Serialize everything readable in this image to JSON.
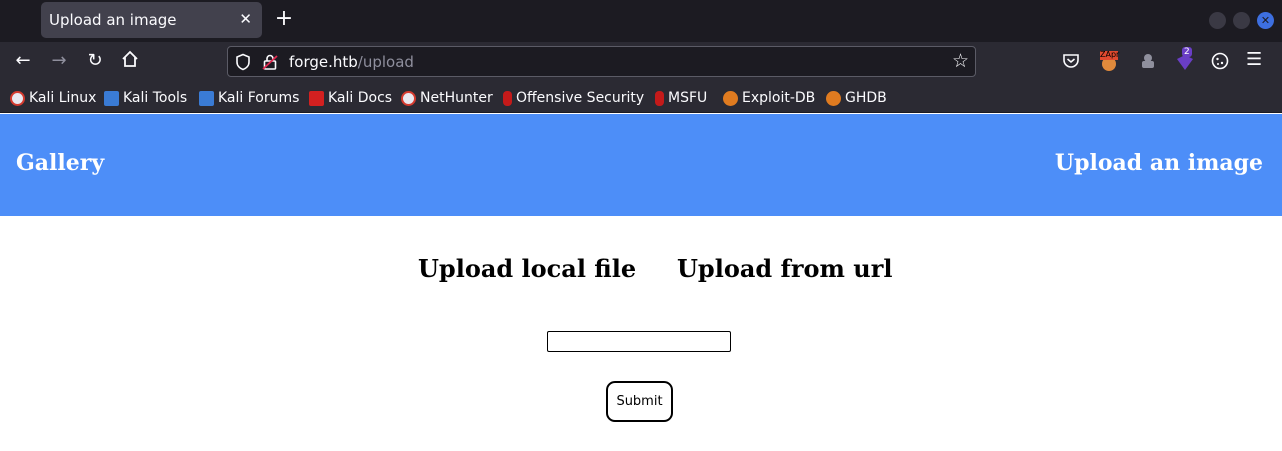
{
  "browser": {
    "tab": {
      "title": "Upload an image"
    },
    "url": {
      "host": "forge.htb",
      "path": "/upload"
    },
    "extensions": [
      {
        "name": "zap-extension",
        "badge": "ZApr"
      },
      {
        "name": "notify-extension",
        "badge": "2"
      }
    ],
    "bookmarks": [
      {
        "label": "Kali Linux",
        "icon": "kali-icon"
      },
      {
        "label": "Kali Tools",
        "icon": "kali-tools-icon"
      },
      {
        "label": "Kali Forums",
        "icon": "kali-forums-icon"
      },
      {
        "label": "Kali Docs",
        "icon": "kali-docs-icon"
      },
      {
        "label": "NetHunter",
        "icon": "nethunter-icon"
      },
      {
        "label": "Offensive Security",
        "icon": "offsec-icon"
      },
      {
        "label": "MSFU",
        "icon": "msfu-icon"
      },
      {
        "label": "Exploit-DB",
        "icon": "exploit-db-icon"
      },
      {
        "label": "GHDB",
        "icon": "ghdb-icon"
      }
    ]
  },
  "header": {
    "brand": "Gallery",
    "upload_link": "Upload an image"
  },
  "options": {
    "local": "Upload local file",
    "url": "Upload from url"
  },
  "form": {
    "url_value": "",
    "submit_label": "Submit"
  },
  "colors": {
    "header_bg": "#4d8ef8",
    "chrome_dark": "#1c1b22",
    "chrome": "#2b2a33"
  }
}
